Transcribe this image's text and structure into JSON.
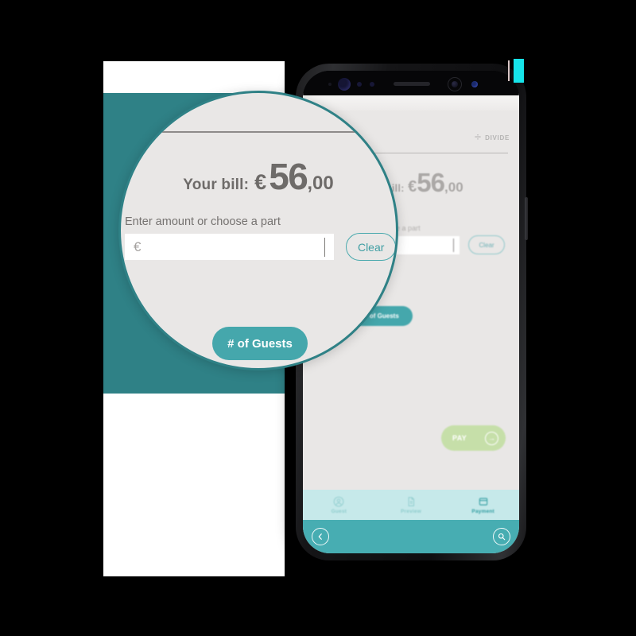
{
  "app": {
    "accent_teal": "#2f8186",
    "button_teal": "#45a7ac",
    "tabbar_teal": "#c6e9ea",
    "bottombar_teal": "#47adb2",
    "pay_green": "#c6dfa9",
    "screen_bg": "#e9e7e6"
  },
  "header": {
    "divide_label": "DIVIDE",
    "divide_icon": "÷"
  },
  "bill": {
    "label": "Your bill:",
    "currency": "€",
    "amount_whole": "56",
    "amount_cents": ",00"
  },
  "amount_section": {
    "hint": "Enter amount or choose a part",
    "input_prefix": "€",
    "input_value": "",
    "clear_label": "Clear"
  },
  "guests": {
    "label": "# of Guests"
  },
  "pay": {
    "label": "PAY",
    "arrow_icon": "→"
  },
  "tabs": [
    {
      "label": "Guest",
      "icon": "user-icon",
      "active": false
    },
    {
      "label": "Preview",
      "icon": "document-icon",
      "active": false
    },
    {
      "label": "Payment",
      "icon": "card-icon",
      "active": true
    }
  ],
  "bottom_bar": {
    "back_icon": "chevron-left-icon",
    "search_icon": "search-icon"
  }
}
